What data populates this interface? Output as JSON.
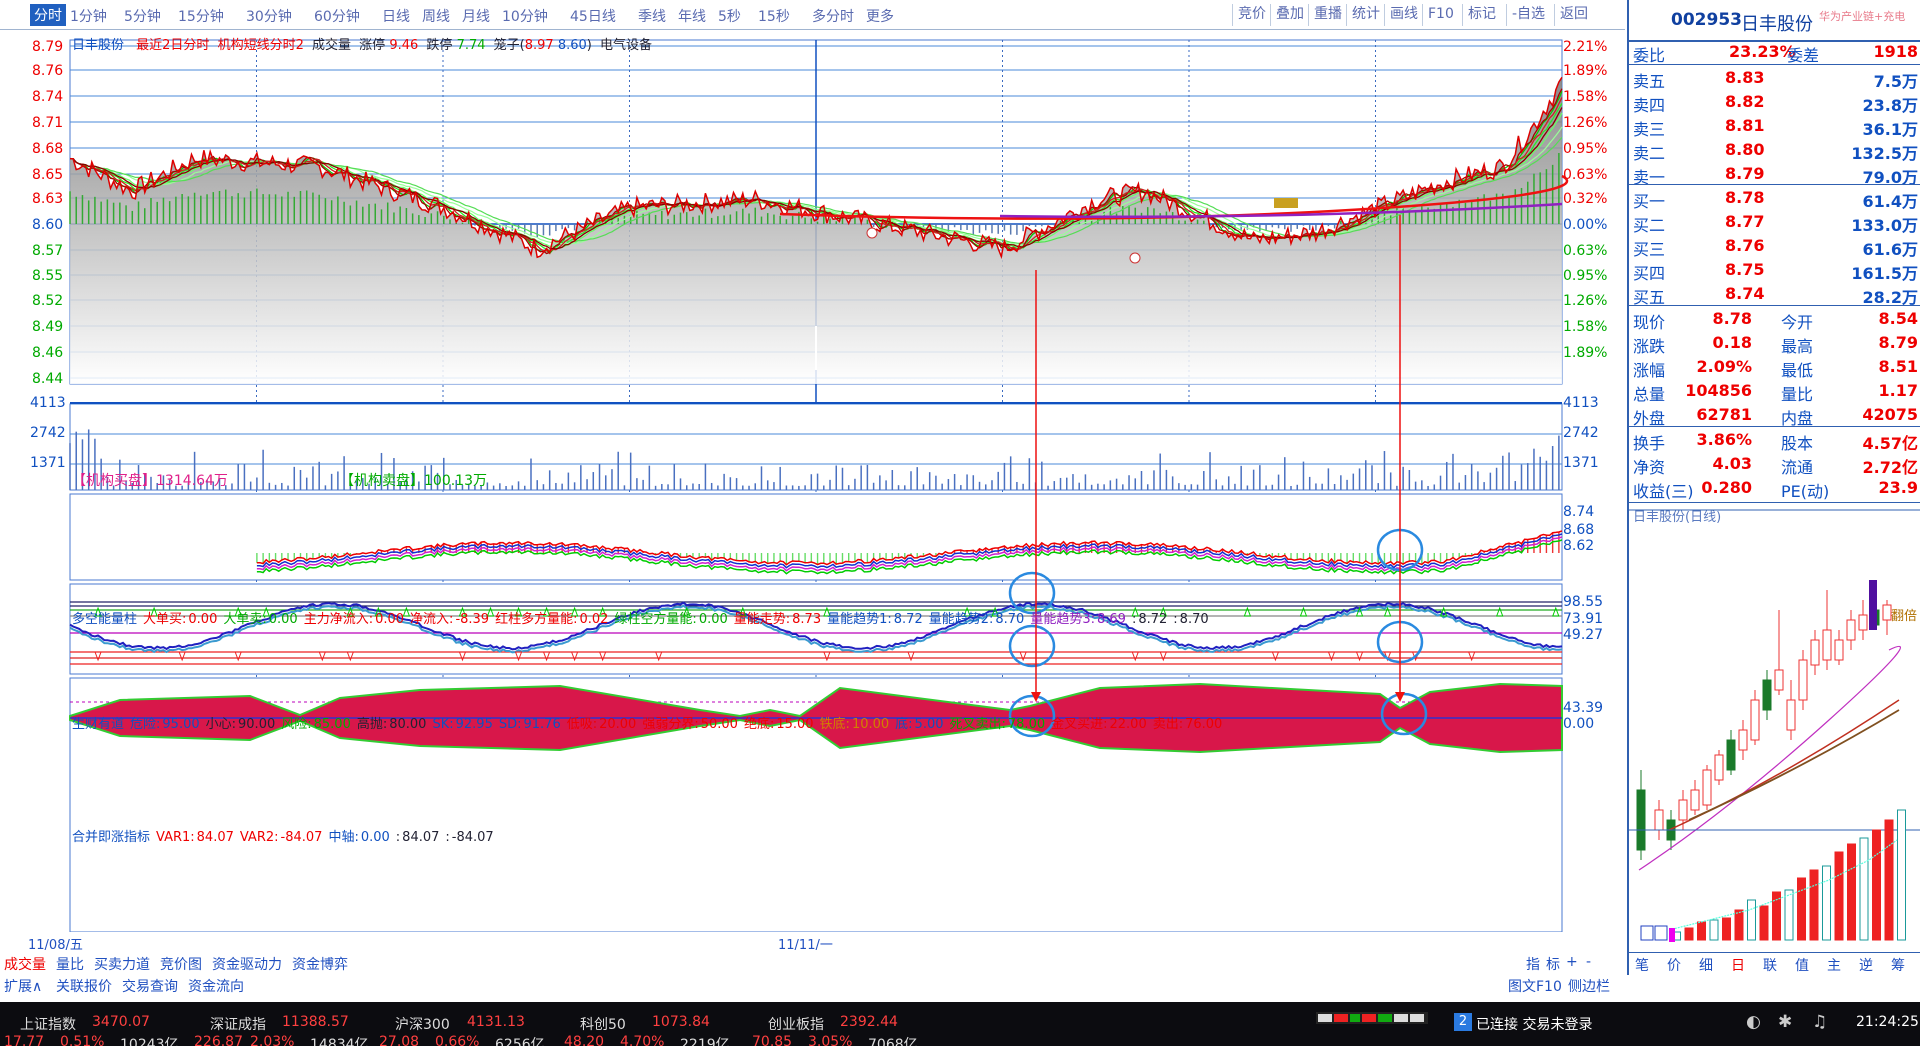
{
  "timeframes": [
    "分时",
    "1分钟",
    "5分钟",
    "15分钟",
    "30分钟",
    "60分钟",
    "日线",
    "周线",
    "月线",
    "10分钟",
    "45日线",
    "季线",
    "年线",
    "5秒",
    "15秒",
    "多分时",
    "更多"
  ],
  "toolbar": [
    "竞价",
    "叠加",
    "重播",
    "统计",
    "画线",
    "F10",
    "标记",
    "-自选",
    "返回"
  ],
  "chart_header": {
    "name": "日丰股份",
    "mode": "最近2日分时",
    "source": "机构短线分时2",
    "vol_label": "成交量",
    "limit_up_label": "涨停",
    "limit_up": "9.46",
    "limit_down_label": "跌停",
    "limit_down": "7.74",
    "cage_label": "笼子",
    "cage_hi": "8.97",
    "cage_lo": "8.60",
    "sector": "电气设备"
  },
  "price_axis": [
    "8.79",
    "8.76",
    "8.74",
    "8.71",
    "8.68",
    "8.65",
    "8.63",
    "8.60",
    "8.57",
    "8.55",
    "8.52",
    "8.49",
    "8.46",
    "8.44"
  ],
  "pct_axis": [
    "2.21%",
    "1.89%",
    "1.58%",
    "1.26%",
    "0.95%",
    "0.63%",
    "0.32%",
    "0.00%",
    "0.63%",
    "0.95%",
    "1.26%",
    "1.58%",
    "1.89%"
  ],
  "inst": {
    "buy_label": "【机构买盘】",
    "buy": "1314.64万",
    "sell_label": "【机构卖盘】",
    "sell": "100.13万"
  },
  "vol_axis": [
    "4113",
    "2742",
    "1371"
  ],
  "ind1": {
    "title": "多空能量柱",
    "items": [
      {
        "k": "大单买:",
        "v": "0.00",
        "c": "red"
      },
      {
        "k": "大单卖:",
        "v": "0.00",
        "c": "green"
      },
      {
        "k": "主力净流入:",
        "v": "0.00",
        "c": "red"
      },
      {
        "k": "净流入:",
        "v": "-8.39",
        "c": "red"
      },
      {
        "k": "红柱多方量能:",
        "v": "0.02",
        "c": "red"
      },
      {
        "k": "绿柱空方量能:",
        "v": "0.00",
        "c": "green"
      },
      {
        "k": "量能走势:",
        "v": "8.73",
        "c": "red"
      },
      {
        "k": "量能趋势1:",
        "v": "8.72",
        "c": "blue"
      },
      {
        "k": "量能趋势2:",
        "v": "8.70",
        "c": "blue"
      },
      {
        "k": "量能趋势3:",
        "v": "8.69",
        "c": "purple"
      },
      {
        "k": ":",
        "v": "8.72",
        "c": "dk"
      },
      {
        "k": ":",
        "v": "8.70",
        "c": "dk"
      }
    ],
    "axis": [
      "8.74",
      "8.68",
      "8.62"
    ]
  },
  "ind2": {
    "title": "生财有道",
    "items": [
      {
        "k": "危险:",
        "v": "95.00",
        "c": "blue"
      },
      {
        "k": "小心:",
        "v": "90.00",
        "c": "dk"
      },
      {
        "k": "风险:",
        "v": "85.00",
        "c": "green"
      },
      {
        "k": "高抛:",
        "v": "80.00",
        "c": "dk"
      },
      {
        "k": "SK:",
        "v": "92.95",
        "c": "blue"
      },
      {
        "k": "SD:",
        "v": "91.76",
        "c": "blue"
      },
      {
        "k": "低吸:",
        "v": "20.00",
        "c": "red"
      },
      {
        "k": "强弱分界:",
        "v": "50.00",
        "c": "red"
      },
      {
        "k": "绝底:",
        "v": "15.00",
        "c": "red"
      },
      {
        "k": "铁底:",
        "v": "10.00",
        "c": "orange"
      },
      {
        "k": "底:",
        "v": "5.00",
        "c": "blue"
      },
      {
        "k": "死叉卖出:",
        "v": "78.00",
        "c": "green"
      },
      {
        "k": "金叉买进:",
        "v": "22.00",
        "c": "red"
      },
      {
        "k": "卖出:",
        "v": "76.00",
        "c": "red"
      }
    ],
    "axis": [
      "98.55",
      "73.91",
      "49.27"
    ]
  },
  "ind3": {
    "title": "合并即涨指标",
    "items": [
      {
        "k": "VAR1:",
        "v": "84.07",
        "c": "red"
      },
      {
        "k": "VAR2:",
        "v": "-84.07",
        "c": "red"
      },
      {
        "k": "中轴:",
        "v": "0.00",
        "c": "blue"
      },
      {
        "k": ":",
        "v": "84.07",
        "c": "dk"
      },
      {
        "k": ":",
        "v": "-84.07",
        "c": "dk"
      }
    ],
    "axis": [
      "43.39",
      "0.00"
    ]
  },
  "dates": [
    "11/08/五",
    "11/11/一"
  ],
  "tabs_row1": [
    "成交量",
    "量比",
    "买卖力道",
    "竞价图",
    "资金驱动力",
    "资金博弈"
  ],
  "tabs_row1_right": [
    "指",
    "标",
    "+",
    "-"
  ],
  "tabs_row2": [
    "扩展∧",
    "关联报价",
    "交易查询",
    "资金流向"
  ],
  "tabs_row2_right": [
    "图文F10",
    "侧边栏"
  ],
  "stock": {
    "code": "002953",
    "name": "日丰股份",
    "tag": "华为产业链+充电"
  },
  "weibi": {
    "label": "委比",
    "val": "23.23%",
    "label2": "委差",
    "val2": "1918"
  },
  "asks": [
    {
      "l": "卖五",
      "p": "8.83",
      "v": "7.5万"
    },
    {
      "l": "卖四",
      "p": "8.82",
      "v": "23.8万"
    },
    {
      "l": "卖三",
      "p": "8.81",
      "v": "36.1万"
    },
    {
      "l": "卖二",
      "p": "8.80",
      "v": "132.5万"
    },
    {
      "l": "卖一",
      "p": "8.79",
      "v": "79.0万"
    }
  ],
  "bids": [
    {
      "l": "买一",
      "p": "8.78",
      "v": "61.4万"
    },
    {
      "l": "买二",
      "p": "8.77",
      "v": "133.0万"
    },
    {
      "l": "买三",
      "p": "8.76",
      "v": "61.6万"
    },
    {
      "l": "买四",
      "p": "8.75",
      "v": "161.5万"
    },
    {
      "l": "买五",
      "p": "8.74",
      "v": "28.2万"
    }
  ],
  "stats1": [
    {
      "l": "现价",
      "v": "8.78",
      "l2": "今开",
      "v2": "8.54"
    },
    {
      "l": "涨跌",
      "v": "0.18",
      "l2": "最高",
      "v2": "8.79"
    },
    {
      "l": "涨幅",
      "v": "2.09%",
      "l2": "最低",
      "v2": "8.51"
    },
    {
      "l": "总量",
      "v": "104856",
      "l2": "量比",
      "v2": "1.17"
    },
    {
      "l": "外盘",
      "v": "62781",
      "l2": "内盘",
      "v2": "42075"
    }
  ],
  "stats2": [
    {
      "l": "换手",
      "v": "3.86%",
      "l2": "股本",
      "v2": "4.57亿"
    },
    {
      "l": "净资",
      "v": "4.03",
      "l2": "流通",
      "v2": "2.72亿"
    },
    {
      "l": "收益(三)",
      "v": "0.280",
      "l2": "PE(动)",
      "v2": "23.9"
    }
  ],
  "mini_title": "日丰股份(日线)",
  "mini_label": "翻倍",
  "side_tabs": [
    "笔",
    "价",
    "细",
    "日",
    "联",
    "值",
    "主",
    "逆",
    "筹"
  ],
  "indices": [
    {
      "n": "上证指数",
      "p": "3470.07",
      "c": "17.77",
      "pct": "0.51%",
      "amt": "10243亿"
    },
    {
      "n": "深证成指",
      "p": "11388.57",
      "c": "226.87",
      "pct": "2.03%",
      "amt": "14834亿"
    },
    {
      "n": "沪深300",
      "p": "4131.13",
      "c": "27.08",
      "pct": "0.66%",
      "amt": "6256亿"
    },
    {
      "n": "科创50",
      "p": "1073.84",
      "c": "48.20",
      "pct": "4.70%",
      "amt": "2219亿"
    },
    {
      "n": "创业板指",
      "p": "2392.44",
      "c": "70.85",
      "pct": "3.05%",
      "amt": "7068亿"
    }
  ],
  "status": {
    "num": "2",
    "text": "已连接 交易未登录",
    "time": "21:24:25"
  }
}
